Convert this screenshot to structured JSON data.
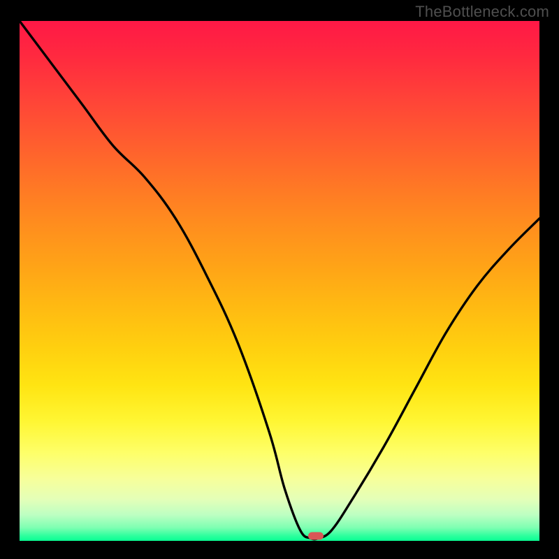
{
  "watermark": "TheBottleneck.com",
  "chart_data": {
    "type": "line",
    "title": "",
    "xlabel": "",
    "ylabel": "",
    "xlim": [
      0,
      100
    ],
    "ylim": [
      0,
      100
    ],
    "grid": false,
    "legend": false,
    "series": [
      {
        "name": "bottleneck-curve",
        "x": [
          0,
          6,
          12,
          18,
          24,
          30,
          36,
          42,
          48,
          51,
          54,
          56,
          57.5,
          60,
          64,
          70,
          76,
          82,
          88,
          94,
          100
        ],
        "y": [
          100,
          92,
          84,
          76,
          70,
          62,
          51,
          38,
          21,
          10,
          2,
          0.5,
          0.5,
          2,
          8,
          18,
          29,
          40,
          49,
          56,
          62
        ]
      }
    ],
    "minimum_marker": {
      "x": 57,
      "y": 1
    },
    "colors": {
      "curve": "#000000",
      "marker": "#d95757",
      "gradient_top": "#ff1846",
      "gradient_bottom": "#0aff93"
    }
  }
}
